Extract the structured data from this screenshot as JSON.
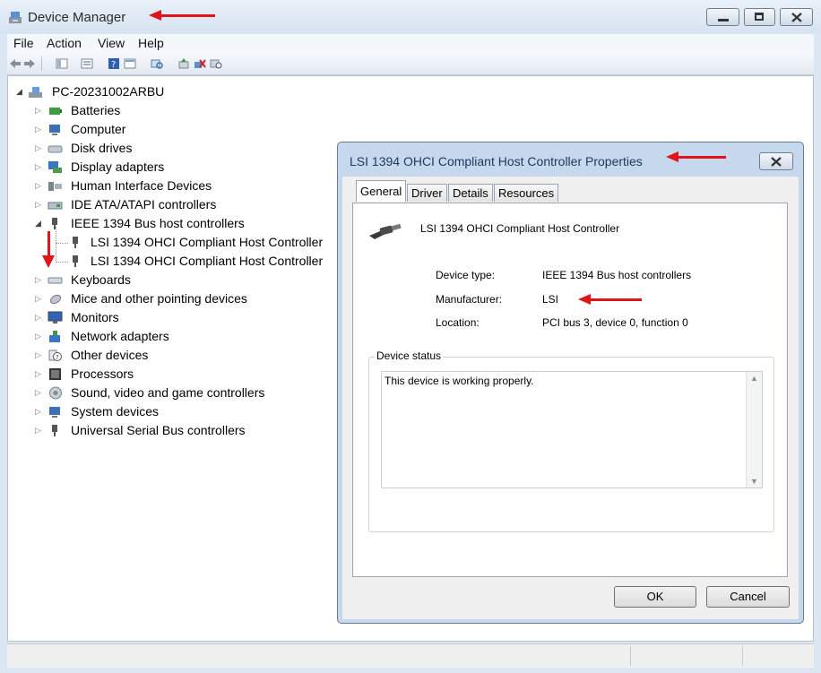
{
  "window": {
    "title": "Device Manager"
  },
  "menu": [
    "File",
    "Action",
    "View",
    "Help"
  ],
  "tree": {
    "root": "PC-20231002ARBU",
    "items": [
      {
        "label": "Batteries",
        "icon": "battery-icon"
      },
      {
        "label": "Computer",
        "icon": "computer-icon"
      },
      {
        "label": "Disk drives",
        "icon": "disk-drive-icon"
      },
      {
        "label": "Display adapters",
        "icon": "display-adapter-icon"
      },
      {
        "label": "Human Interface Devices",
        "icon": "hid-icon"
      },
      {
        "label": "IDE ATA/ATAPI controllers",
        "icon": "ide-controller-icon"
      },
      {
        "label": "IEEE 1394 Bus host controllers",
        "icon": "ieee1394-icon"
      },
      {
        "label": "LSI 1394 OHCI Compliant Host Controller",
        "icon": "ieee1394-device-icon"
      },
      {
        "label": "LSI 1394 OHCI Compliant Host Controller",
        "icon": "ieee1394-device-icon"
      },
      {
        "label": "Keyboards",
        "icon": "keyboard-icon"
      },
      {
        "label": "Mice and other pointing devices",
        "icon": "mouse-icon"
      },
      {
        "label": "Monitors",
        "icon": "monitor-icon"
      },
      {
        "label": "Network adapters",
        "icon": "network-adapter-icon"
      },
      {
        "label": "Other devices",
        "icon": "unknown-device-icon"
      },
      {
        "label": "Processors",
        "icon": "processor-icon"
      },
      {
        "label": "Sound, video and game controllers",
        "icon": "sound-icon"
      },
      {
        "label": "System devices",
        "icon": "system-device-icon"
      },
      {
        "label": "Universal Serial Bus controllers",
        "icon": "usb-icon"
      }
    ]
  },
  "dialog": {
    "title": "LSI 1394 OHCI Compliant Host Controller Properties",
    "tabs": [
      "General",
      "Driver",
      "Details",
      "Resources"
    ],
    "active_tab": "General",
    "device_name": "LSI 1394 OHCI Compliant Host Controller",
    "props": [
      {
        "name": "Device type:",
        "value": "IEEE 1394 Bus host controllers"
      },
      {
        "name": "Manufacturer:",
        "value": "LSI"
      },
      {
        "name": "Location:",
        "value": "PCI bus 3, device 0, function 0"
      }
    ],
    "status_group": "Device status",
    "status_text": "This device is working properly.",
    "ok": "OK",
    "cancel": "Cancel"
  },
  "colors": {
    "annotation_arrow": "#e0141b",
    "window_frame": "#dce7f3"
  }
}
